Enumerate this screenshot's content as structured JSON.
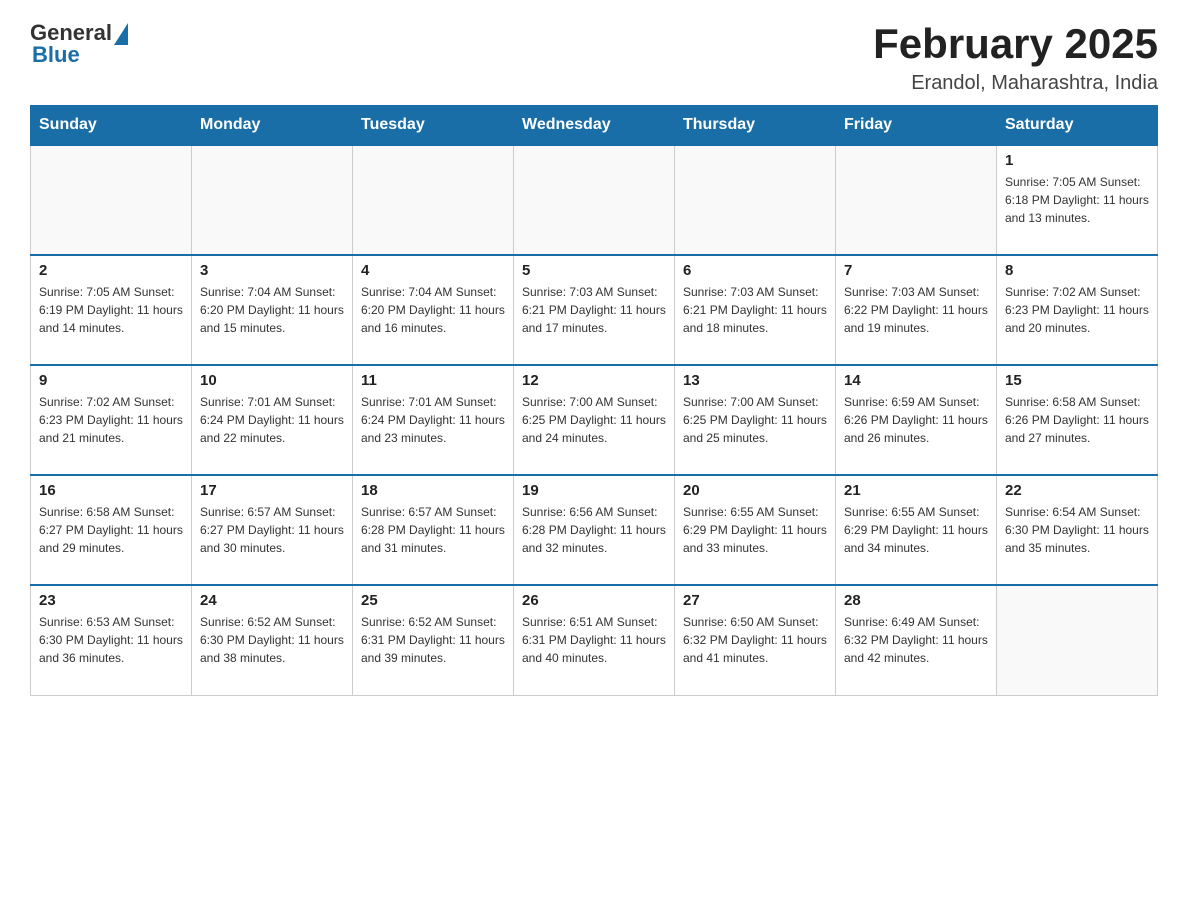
{
  "header": {
    "logo": {
      "general": "General",
      "blue": "Blue"
    },
    "title": "February 2025",
    "location": "Erandol, Maharashtra, India"
  },
  "days_of_week": [
    "Sunday",
    "Monday",
    "Tuesday",
    "Wednesday",
    "Thursday",
    "Friday",
    "Saturday"
  ],
  "weeks": [
    [
      {
        "day": "",
        "info": ""
      },
      {
        "day": "",
        "info": ""
      },
      {
        "day": "",
        "info": ""
      },
      {
        "day": "",
        "info": ""
      },
      {
        "day": "",
        "info": ""
      },
      {
        "day": "",
        "info": ""
      },
      {
        "day": "1",
        "info": "Sunrise: 7:05 AM\nSunset: 6:18 PM\nDaylight: 11 hours and 13 minutes."
      }
    ],
    [
      {
        "day": "2",
        "info": "Sunrise: 7:05 AM\nSunset: 6:19 PM\nDaylight: 11 hours and 14 minutes."
      },
      {
        "day": "3",
        "info": "Sunrise: 7:04 AM\nSunset: 6:20 PM\nDaylight: 11 hours and 15 minutes."
      },
      {
        "day": "4",
        "info": "Sunrise: 7:04 AM\nSunset: 6:20 PM\nDaylight: 11 hours and 16 minutes."
      },
      {
        "day": "5",
        "info": "Sunrise: 7:03 AM\nSunset: 6:21 PM\nDaylight: 11 hours and 17 minutes."
      },
      {
        "day": "6",
        "info": "Sunrise: 7:03 AM\nSunset: 6:21 PM\nDaylight: 11 hours and 18 minutes."
      },
      {
        "day": "7",
        "info": "Sunrise: 7:03 AM\nSunset: 6:22 PM\nDaylight: 11 hours and 19 minutes."
      },
      {
        "day": "8",
        "info": "Sunrise: 7:02 AM\nSunset: 6:23 PM\nDaylight: 11 hours and 20 minutes."
      }
    ],
    [
      {
        "day": "9",
        "info": "Sunrise: 7:02 AM\nSunset: 6:23 PM\nDaylight: 11 hours and 21 minutes."
      },
      {
        "day": "10",
        "info": "Sunrise: 7:01 AM\nSunset: 6:24 PM\nDaylight: 11 hours and 22 minutes."
      },
      {
        "day": "11",
        "info": "Sunrise: 7:01 AM\nSunset: 6:24 PM\nDaylight: 11 hours and 23 minutes."
      },
      {
        "day": "12",
        "info": "Sunrise: 7:00 AM\nSunset: 6:25 PM\nDaylight: 11 hours and 24 minutes."
      },
      {
        "day": "13",
        "info": "Sunrise: 7:00 AM\nSunset: 6:25 PM\nDaylight: 11 hours and 25 minutes."
      },
      {
        "day": "14",
        "info": "Sunrise: 6:59 AM\nSunset: 6:26 PM\nDaylight: 11 hours and 26 minutes."
      },
      {
        "day": "15",
        "info": "Sunrise: 6:58 AM\nSunset: 6:26 PM\nDaylight: 11 hours and 27 minutes."
      }
    ],
    [
      {
        "day": "16",
        "info": "Sunrise: 6:58 AM\nSunset: 6:27 PM\nDaylight: 11 hours and 29 minutes."
      },
      {
        "day": "17",
        "info": "Sunrise: 6:57 AM\nSunset: 6:27 PM\nDaylight: 11 hours and 30 minutes."
      },
      {
        "day": "18",
        "info": "Sunrise: 6:57 AM\nSunset: 6:28 PM\nDaylight: 11 hours and 31 minutes."
      },
      {
        "day": "19",
        "info": "Sunrise: 6:56 AM\nSunset: 6:28 PM\nDaylight: 11 hours and 32 minutes."
      },
      {
        "day": "20",
        "info": "Sunrise: 6:55 AM\nSunset: 6:29 PM\nDaylight: 11 hours and 33 minutes."
      },
      {
        "day": "21",
        "info": "Sunrise: 6:55 AM\nSunset: 6:29 PM\nDaylight: 11 hours and 34 minutes."
      },
      {
        "day": "22",
        "info": "Sunrise: 6:54 AM\nSunset: 6:30 PM\nDaylight: 11 hours and 35 minutes."
      }
    ],
    [
      {
        "day": "23",
        "info": "Sunrise: 6:53 AM\nSunset: 6:30 PM\nDaylight: 11 hours and 36 minutes."
      },
      {
        "day": "24",
        "info": "Sunrise: 6:52 AM\nSunset: 6:30 PM\nDaylight: 11 hours and 38 minutes."
      },
      {
        "day": "25",
        "info": "Sunrise: 6:52 AM\nSunset: 6:31 PM\nDaylight: 11 hours and 39 minutes."
      },
      {
        "day": "26",
        "info": "Sunrise: 6:51 AM\nSunset: 6:31 PM\nDaylight: 11 hours and 40 minutes."
      },
      {
        "day": "27",
        "info": "Sunrise: 6:50 AM\nSunset: 6:32 PM\nDaylight: 11 hours and 41 minutes."
      },
      {
        "day": "28",
        "info": "Sunrise: 6:49 AM\nSunset: 6:32 PM\nDaylight: 11 hours and 42 minutes."
      },
      {
        "day": "",
        "info": ""
      }
    ]
  ]
}
